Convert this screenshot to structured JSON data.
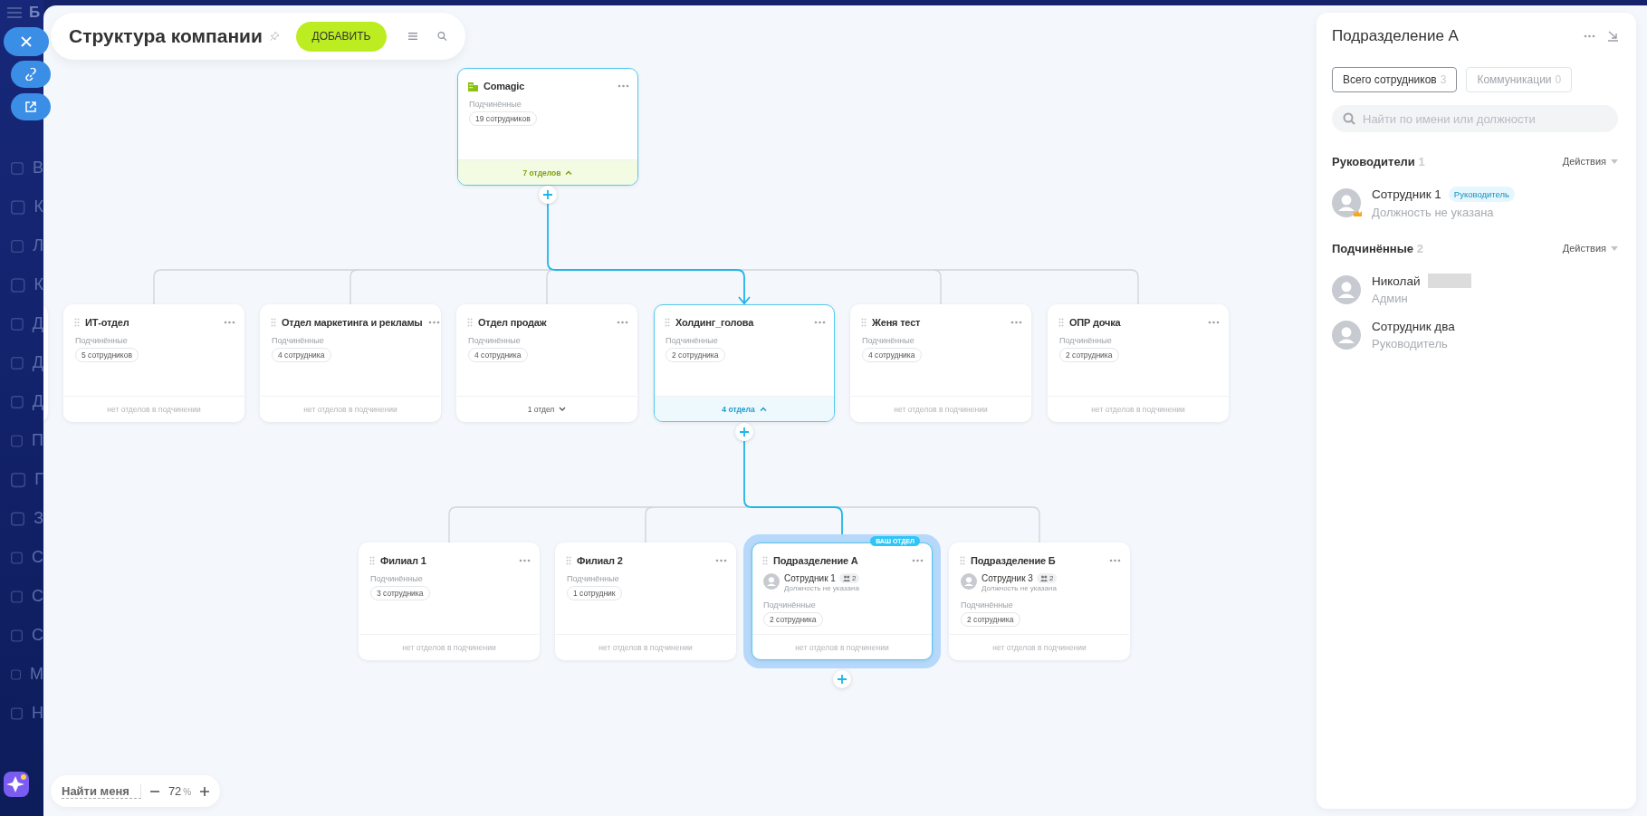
{
  "sidebar": {
    "title_letter": "Б",
    "items": [
      "В",
      "К",
      "Л",
      "К",
      "Д",
      "Д",
      "Д",
      "П",
      "Г",
      "З",
      "С",
      "С",
      "С",
      "М",
      "Н"
    ]
  },
  "header": {
    "title": "Структура компании",
    "add_button": "ДОБАВИТЬ"
  },
  "tree": {
    "title": "Comagic",
    "kind": "company",
    "highlighted": true,
    "selected": false,
    "subordinates_label": "Подчинённые",
    "count": "19 сотрудников",
    "footer": "7 отделов",
    "expanded": true,
    "children": [
      {
        "title": "ИТ-отдел",
        "kind": "department",
        "highlighted": false,
        "selected": false,
        "subordinates_label": "Подчинённые",
        "count": "5 сотрудников",
        "footer": "нет отделов в подчинении"
      },
      {
        "title": "Отдел маркетинга и рекламы",
        "kind": "department",
        "highlighted": false,
        "selected": false,
        "subordinates_label": "Подчинённые",
        "count": "4 сотрудника",
        "footer": "нет отделов в подчинении"
      },
      {
        "title": "Отдел продаж",
        "kind": "department",
        "highlighted": false,
        "selected": false,
        "subordinates_label": "Подчинённые",
        "count": "4 сотрудника",
        "footer": "1 отдел",
        "expanded": false
      },
      {
        "title": "Холдинг_голова",
        "kind": "department",
        "highlighted": true,
        "selected": false,
        "subordinates_label": "Подчинённые",
        "count": "2 сотрудника",
        "footer": "4 отдела",
        "expanded": true,
        "children": [
          {
            "title": "Филиал 1",
            "kind": "department",
            "highlighted": false,
            "selected": false,
            "subordinates_label": "Подчинённые",
            "count": "3 сотрудника",
            "footer": "нет отделов в подчинении"
          },
          {
            "title": "Филиал 2",
            "kind": "department",
            "highlighted": false,
            "selected": false,
            "subordinates_label": "Подчинённые",
            "count": "1 сотрудник",
            "footer": "нет отделов в подчинении"
          },
          {
            "title": "Подразделение А",
            "kind": "department",
            "highlighted": true,
            "selected": true,
            "badge": "ВАШ ОТДЕЛ",
            "head": {
              "name": "Сотрудник 1",
              "count": "2",
              "position": "Должность не указана"
            },
            "subordinates_label": "Подчинённые",
            "count": "2 сотрудника",
            "footer": "нет отделов в подчинении"
          },
          {
            "title": "Подразделение Б",
            "kind": "department",
            "highlighted": false,
            "selected": false,
            "head": {
              "name": "Сотрудник 3",
              "count": "2",
              "position": "Должность не указана"
            },
            "subordinates_label": "Подчинённые",
            "count": "2 сотрудника",
            "footer": "нет отделов в подчинении"
          }
        ]
      },
      {
        "title": "Женя тест",
        "kind": "department",
        "highlighted": false,
        "selected": false,
        "subordinates_label": "Подчинённые",
        "count": "4 сотрудника",
        "footer": "нет отделов в подчинении"
      },
      {
        "title": "ОПР дочка",
        "kind": "department",
        "highlighted": false,
        "selected": false,
        "subordinates_label": "Подчинённые",
        "count": "2 сотрудника",
        "footer": "нет отделов в подчинении"
      }
    ]
  },
  "panel": {
    "title": "Подразделение А",
    "tabs": [
      {
        "label": "Всего сотрудников",
        "count": "3",
        "selected": true
      },
      {
        "label": "Коммуникации",
        "count": "0",
        "selected": false
      }
    ],
    "search": {
      "placeholder": "Найти по имени или должности"
    },
    "sections": [
      {
        "title": "Руководители",
        "count": "1",
        "action": "Действия",
        "people": [
          {
            "name": "Сотрудник 1",
            "badge": "Руководитель",
            "position": "Должность не указана",
            "crown": true
          }
        ]
      },
      {
        "title": "Подчинённые",
        "count": "2",
        "action": "Действия",
        "people": [
          {
            "name": "Николай",
            "redacted": true,
            "position": "Админ",
            "crown": false
          },
          {
            "name": "Сотрудник два",
            "position": "Руководитель",
            "crown": false
          }
        ]
      }
    ]
  },
  "zoom_bar": {
    "find_me": "Найти меня",
    "zoom": "72",
    "unit": "%"
  }
}
